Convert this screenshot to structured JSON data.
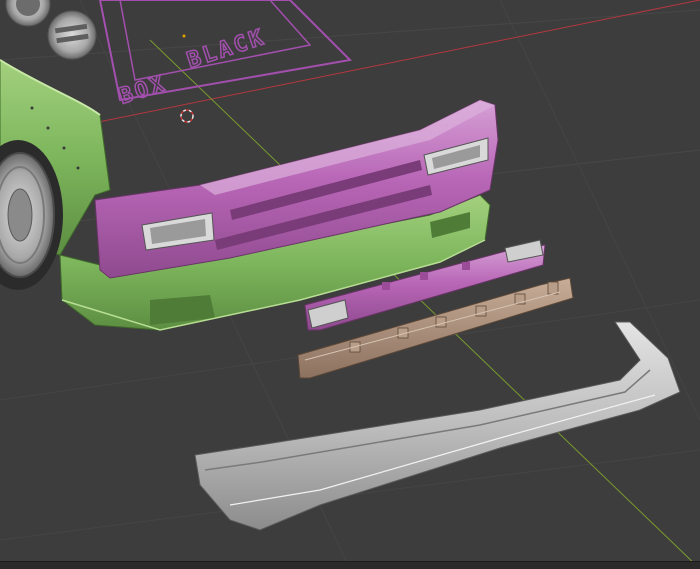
{
  "window": {
    "title": ""
  },
  "colors": {
    "background": "#3d3d3d",
    "grid_line": "#4a4a4a",
    "axis_x": "#b5373f",
    "axis_y": "#7a9a2e",
    "decal": "#a24fae",
    "bumper_magenta": "#b866b6",
    "lip_green": "#7db65c",
    "rebar_brown": "#a68b76",
    "diffuser_gray": "#bdbdbd"
  },
  "decal": {
    "line1": "BLACK",
    "line2": "BOX"
  },
  "objects": [
    {
      "name": "green-car-body"
    },
    {
      "name": "magenta-front-bumper"
    },
    {
      "name": "green-front-lip"
    },
    {
      "name": "magenta-bumper-insert"
    },
    {
      "name": "brown-bumper-reinforcement"
    },
    {
      "name": "gray-front-splitter"
    }
  ],
  "statusbar": {
    "text": ""
  }
}
